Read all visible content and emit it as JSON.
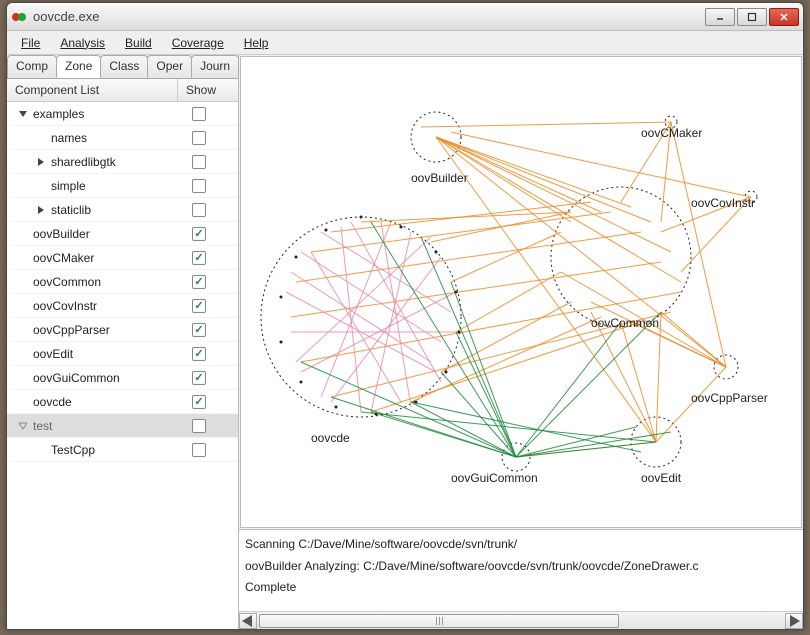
{
  "window": {
    "title": "oovcde.exe"
  },
  "menu": {
    "file": "File",
    "analysis": "Analysis",
    "build": "Build",
    "coverage": "Coverage",
    "help": "Help"
  },
  "tabs": {
    "comp": "Comp",
    "zone": "Zone",
    "class": "Class",
    "oper": "Oper",
    "journ": "Journ"
  },
  "list_header": {
    "col1": "Component List",
    "col2": "Show"
  },
  "tree": [
    {
      "label": "examples",
      "indent": 0,
      "expander": "down",
      "checked": false,
      "selected": false
    },
    {
      "label": "names",
      "indent": 1,
      "expander": "none",
      "checked": false,
      "selected": false
    },
    {
      "label": "sharedlibgtk",
      "indent": 1,
      "expander": "right",
      "checked": false,
      "selected": false
    },
    {
      "label": "simple",
      "indent": 1,
      "expander": "none",
      "checked": false,
      "selected": false
    },
    {
      "label": "staticlib",
      "indent": 1,
      "expander": "right",
      "checked": false,
      "selected": false
    },
    {
      "label": "oovBuilder",
      "indent": 0,
      "expander": "none",
      "checked": true,
      "selected": false
    },
    {
      "label": "oovCMaker",
      "indent": 0,
      "expander": "none",
      "checked": true,
      "selected": false
    },
    {
      "label": "oovCommon",
      "indent": 0,
      "expander": "none",
      "checked": true,
      "selected": false
    },
    {
      "label": "oovCovInstr",
      "indent": 0,
      "expander": "none",
      "checked": true,
      "selected": false
    },
    {
      "label": "oovCppParser",
      "indent": 0,
      "expander": "none",
      "checked": true,
      "selected": false
    },
    {
      "label": "oovEdit",
      "indent": 0,
      "expander": "none",
      "checked": true,
      "selected": false
    },
    {
      "label": "oovGuiCommon",
      "indent": 0,
      "expander": "none",
      "checked": true,
      "selected": false
    },
    {
      "label": "oovcde",
      "indent": 0,
      "expander": "none",
      "checked": true,
      "selected": false
    },
    {
      "label": "test",
      "indent": 0,
      "expander": "down-open",
      "checked": false,
      "selected": true
    },
    {
      "label": "TestCpp",
      "indent": 1,
      "expander": "none",
      "checked": false,
      "selected": false
    }
  ],
  "graph": {
    "nodes": {
      "oovBuilder": "oovBuilder",
      "oovCMaker": "oovCMaker",
      "oovCovInstr": "oovCovInstr",
      "oovCommon": "oovCommon",
      "oovCppParser": "oovCppParser",
      "oovEdit": "oovEdit",
      "oovGuiCommon": "oovGuiCommon",
      "oovcde": "oovcde"
    }
  },
  "log": {
    "line1": "Scanning C:/Dave/Mine/software/oovcde/svn/trunk/",
    "line2": "oovBuilder Analyzing: C:/Dave/Mine/software/oovcde/svn/trunk/oovcde/ZoneDrawer.c",
    "line3": "Complete"
  }
}
